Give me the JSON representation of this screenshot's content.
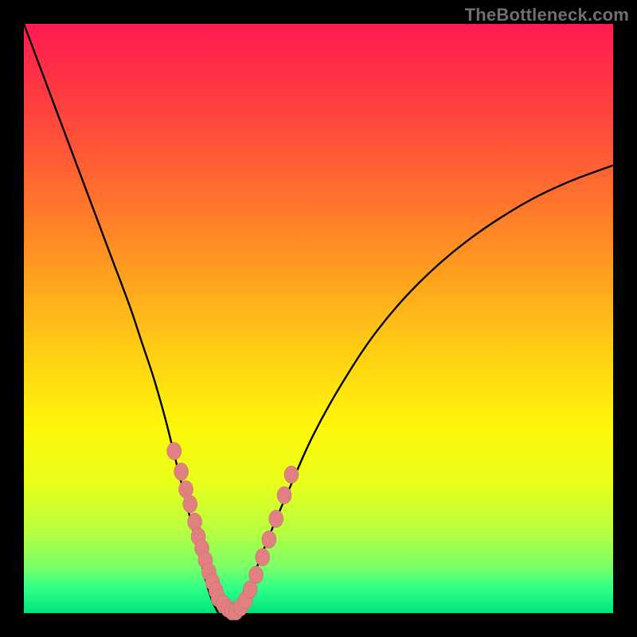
{
  "watermark": "TheBottleneck.com",
  "colors": {
    "page_bg": "#000000",
    "curve": "#000000",
    "marker_fill": "#e08080",
    "marker_stroke": "#c86a6a"
  },
  "chart_data": {
    "type": "line",
    "title": "",
    "xlabel": "",
    "ylabel": "",
    "xlim": [
      0,
      100
    ],
    "ylim": [
      0,
      100
    ],
    "grid": false,
    "curve_left": {
      "x": [
        0,
        3,
        6,
        9,
        12,
        15,
        18,
        20,
        22,
        24,
        25.5,
        27,
        28.5,
        30,
        31,
        32,
        33
      ],
      "y": [
        100,
        92,
        84,
        76,
        68,
        60,
        52,
        46,
        40,
        33,
        27,
        21,
        15,
        9,
        5,
        2,
        0
      ]
    },
    "curve_right": {
      "x": [
        36,
        37,
        38.5,
        40,
        42,
        45,
        49,
        54,
        60,
        67,
        75,
        84,
        92,
        100
      ],
      "y": [
        0,
        2,
        5,
        9,
        14,
        21,
        30,
        39,
        48,
        56,
        63,
        69,
        73,
        76
      ]
    },
    "markers_left": {
      "x": [
        25.5,
        26.7,
        27.5,
        28.2,
        29.0,
        29.6,
        30.2,
        30.8,
        31.4,
        32.0,
        32.6,
        33.0,
        33.8,
        34.6,
        35.3
      ],
      "y": [
        27.5,
        24.0,
        21.0,
        18.5,
        15.5,
        13.0,
        11.0,
        9.0,
        7.0,
        5.3,
        3.8,
        2.5,
        1.6,
        0.8,
        0.3
      ]
    },
    "markers_right": {
      "x": [
        36.0,
        36.8,
        37.6,
        38.4,
        39.4,
        40.5,
        41.6,
        42.8,
        44.2,
        45.4
      ],
      "y": [
        0.3,
        1.0,
        2.2,
        4.0,
        6.5,
        9.5,
        12.5,
        16.0,
        20.0,
        23.5
      ]
    }
  }
}
